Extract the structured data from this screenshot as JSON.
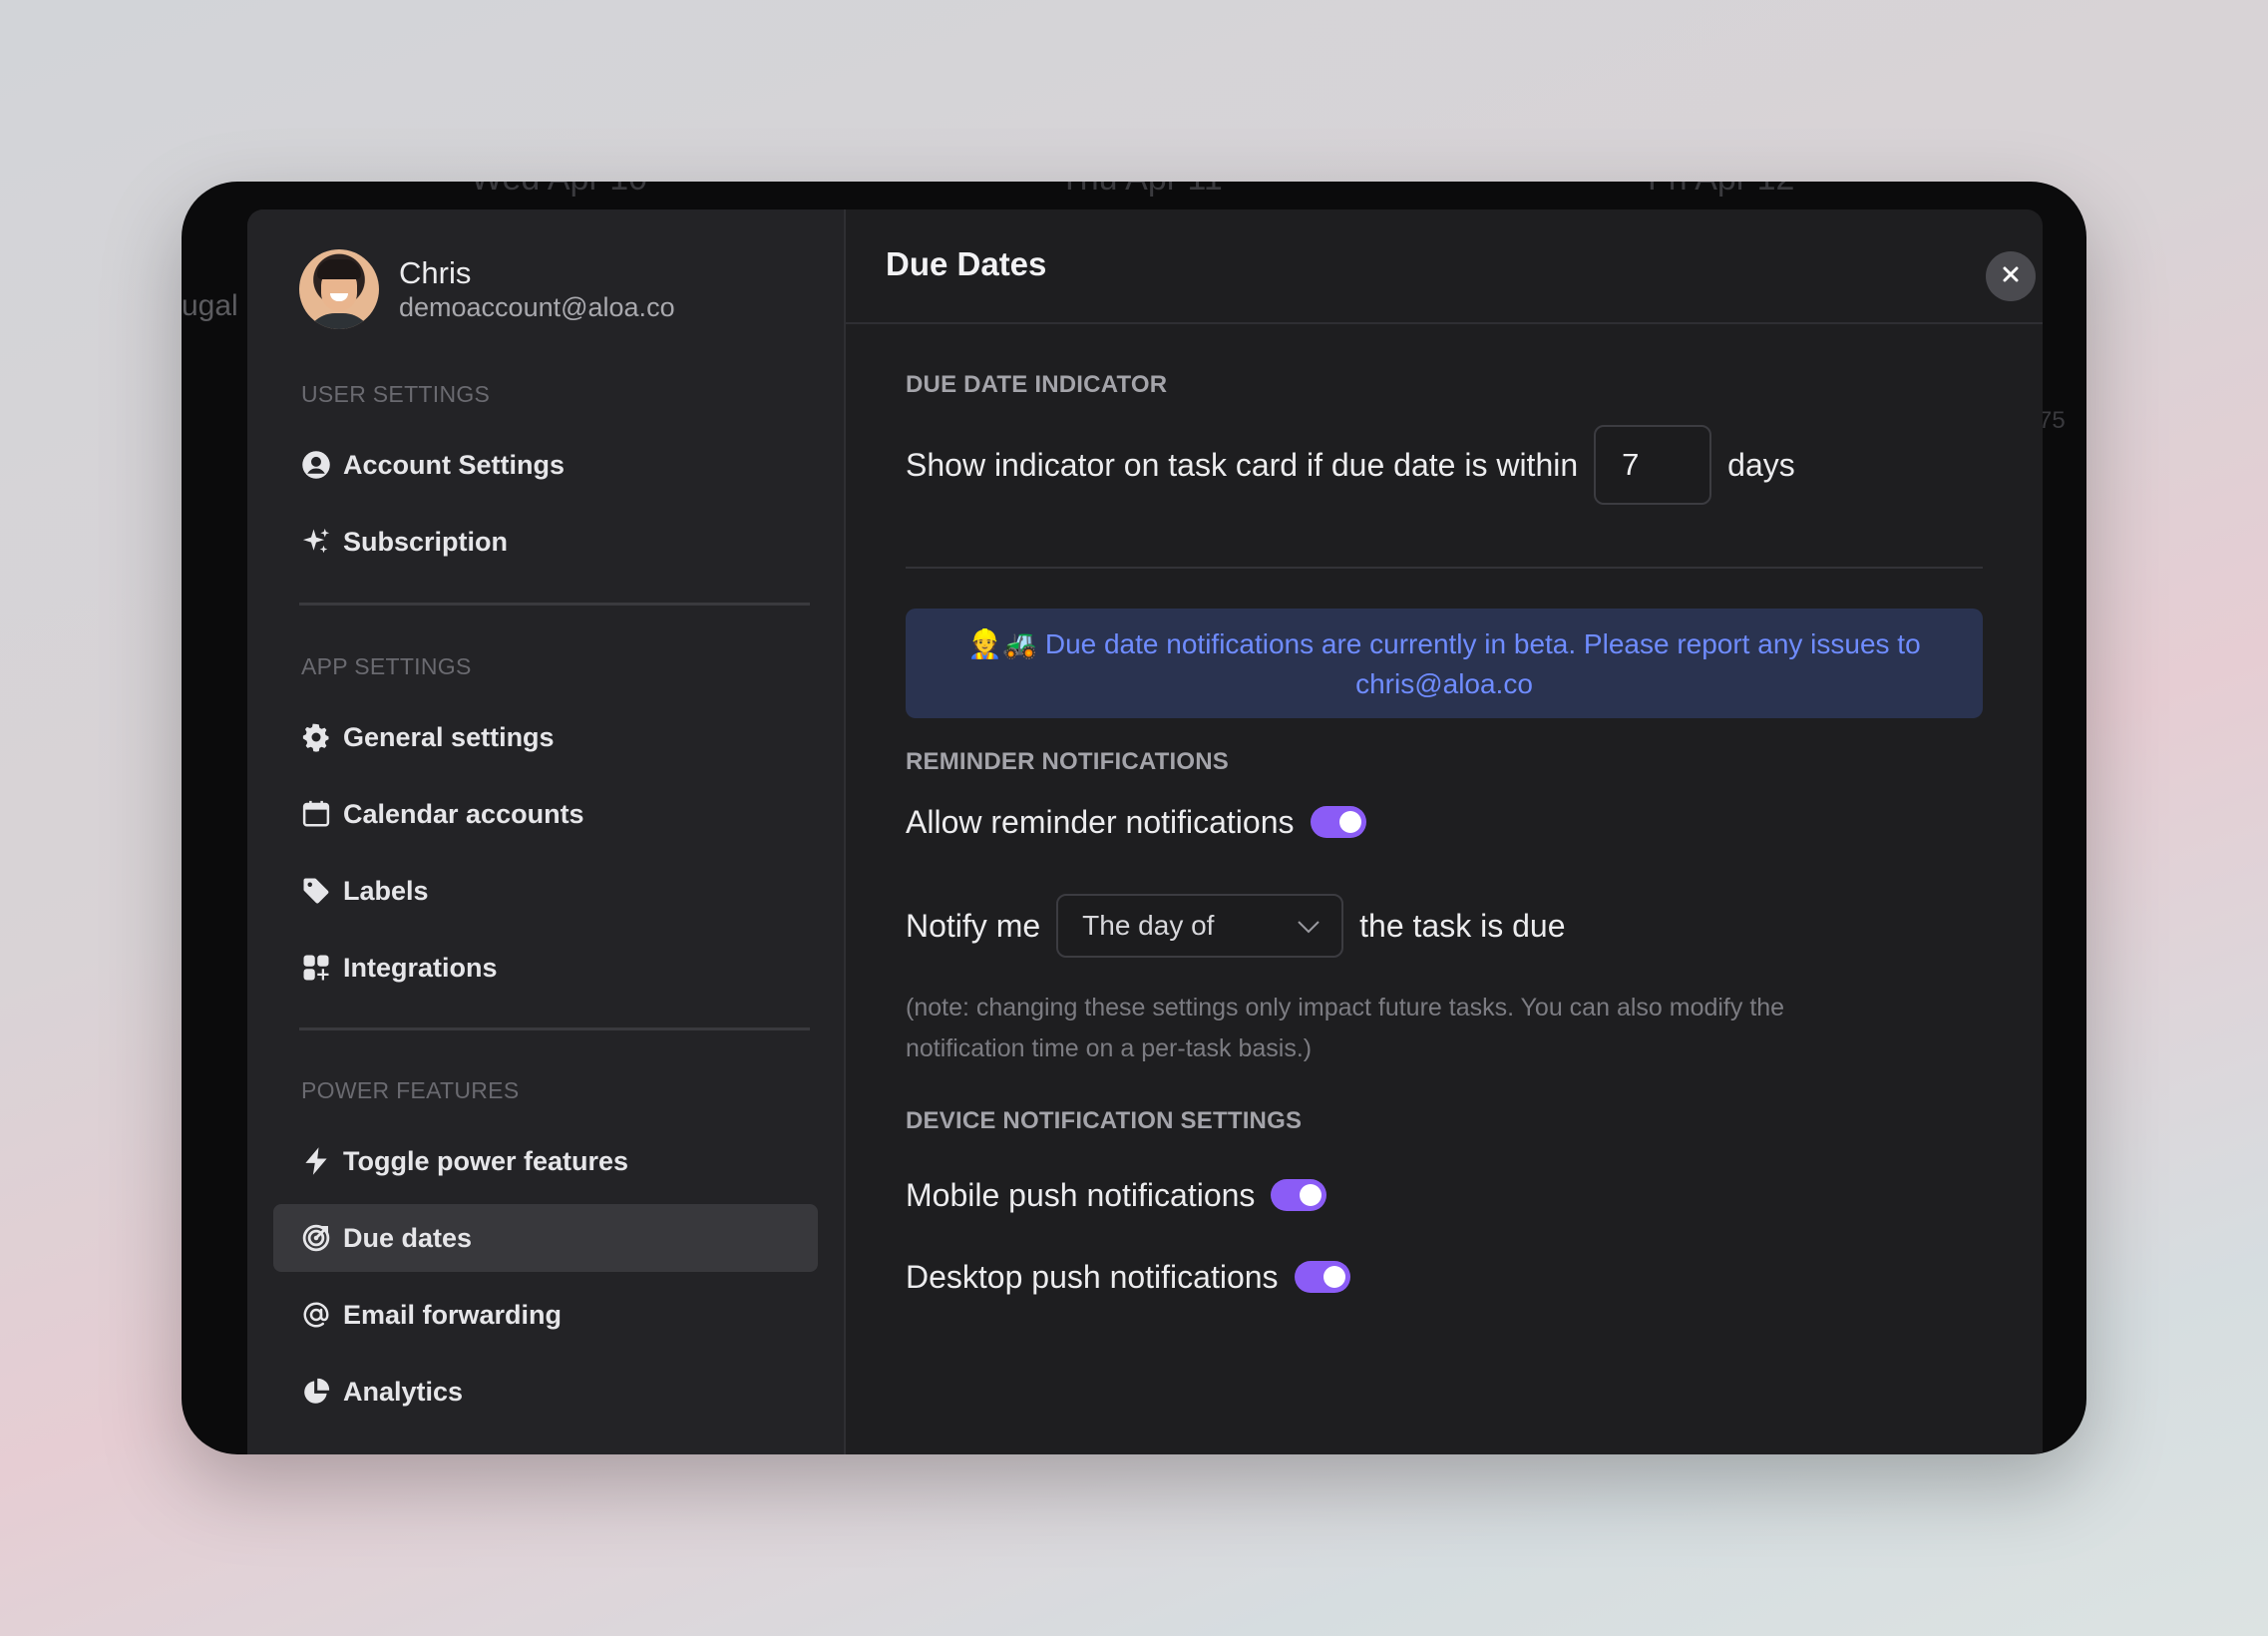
{
  "background": {
    "ghost_texts": [
      "Wed Apr 10",
      "Thu Apr 11",
      "Fri Apr 12",
      "ugal",
      "75"
    ]
  },
  "profile": {
    "name": "Chris",
    "email": "demoaccount@aloa.co"
  },
  "sidebar": {
    "sections": [
      {
        "label": "USER SETTINGS"
      },
      {
        "label": "APP SETTINGS"
      },
      {
        "label": "POWER FEATURES"
      }
    ],
    "items": [
      {
        "label": "Account Settings",
        "icon": "user-circle-icon"
      },
      {
        "label": "Subscription",
        "icon": "sparkles-icon"
      },
      {
        "label": "General settings",
        "icon": "gear-icon"
      },
      {
        "label": "Calendar accounts",
        "icon": "calendar-icon"
      },
      {
        "label": "Labels",
        "icon": "tag-icon"
      },
      {
        "label": "Integrations",
        "icon": "grid-plus-icon"
      },
      {
        "label": "Toggle power features",
        "icon": "lightning-icon"
      },
      {
        "label": "Due dates",
        "icon": "target-icon",
        "active": true
      },
      {
        "label": "Email forwarding",
        "icon": "at-sign-icon"
      },
      {
        "label": "Analytics",
        "icon": "pie-chart-icon"
      }
    ]
  },
  "main": {
    "title": "Due Dates",
    "due_date_indicator": {
      "heading": "DUE DATE INDICATOR",
      "prefix": "Show indicator on task card if due date is within",
      "value": "7",
      "suffix": "days"
    },
    "beta_banner": {
      "emoji": "👷🚜",
      "text": "Due date notifications are currently in beta. Please report any issues to",
      "email": "chris@aloa.co"
    },
    "reminder": {
      "heading": "REMINDER NOTIFICATIONS",
      "allow_label": "Allow reminder notifications",
      "allow_enabled": true,
      "notify_prefix": "Notify me",
      "notify_selected": "The day of",
      "notify_suffix": "the task is due",
      "note": "(note: changing these settings only impact future tasks. You can also modify the notification time on a per-task basis.)"
    },
    "device": {
      "heading": "DEVICE NOTIFICATION SETTINGS",
      "mobile_label": "Mobile push notifications",
      "mobile_enabled": true,
      "desktop_label": "Desktop push notifications",
      "desktop_enabled": true
    }
  },
  "colors": {
    "accent": "#8b5cf6",
    "beta_bg": "#2a3350",
    "beta_text": "#6f8cff"
  }
}
